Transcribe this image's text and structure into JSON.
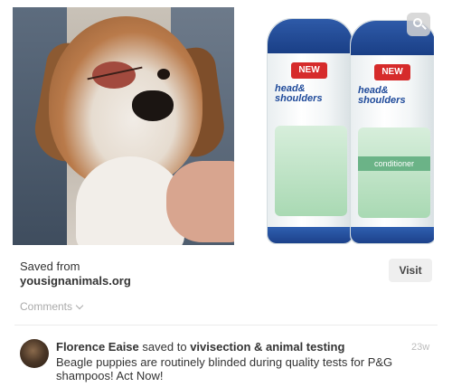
{
  "pin": {
    "image_left_alt": "beagle-with-injured-eye",
    "image_right_alt": "head-and-shoulders-shampoo-and-conditioner",
    "zoom_icon": "magnify-icon",
    "bottle_left": {
      "badge": "NEW",
      "brand_line1": "head&",
      "brand_line2": "shoulders"
    },
    "bottle_right": {
      "badge": "NEW",
      "brand_line1": "head&",
      "brand_line2": "shoulders",
      "label": "conditioner"
    }
  },
  "source": {
    "saved_from_label": "Saved from",
    "domain": "yousignanimals.org",
    "visit_label": "Visit"
  },
  "comments": {
    "toggle_label": "Comments"
  },
  "activity": {
    "user_name": "Florence Eaise",
    "action": "saved to",
    "board": "vivisection & animal testing",
    "description": "Beagle puppies are routinely blinded during quality tests for P&G shampoos! Act Now!",
    "timestamp": "23w"
  },
  "colors": {
    "cap_blue": "#1a3f86",
    "badge_red": "#d62b2b",
    "button_bg": "#efefef"
  }
}
